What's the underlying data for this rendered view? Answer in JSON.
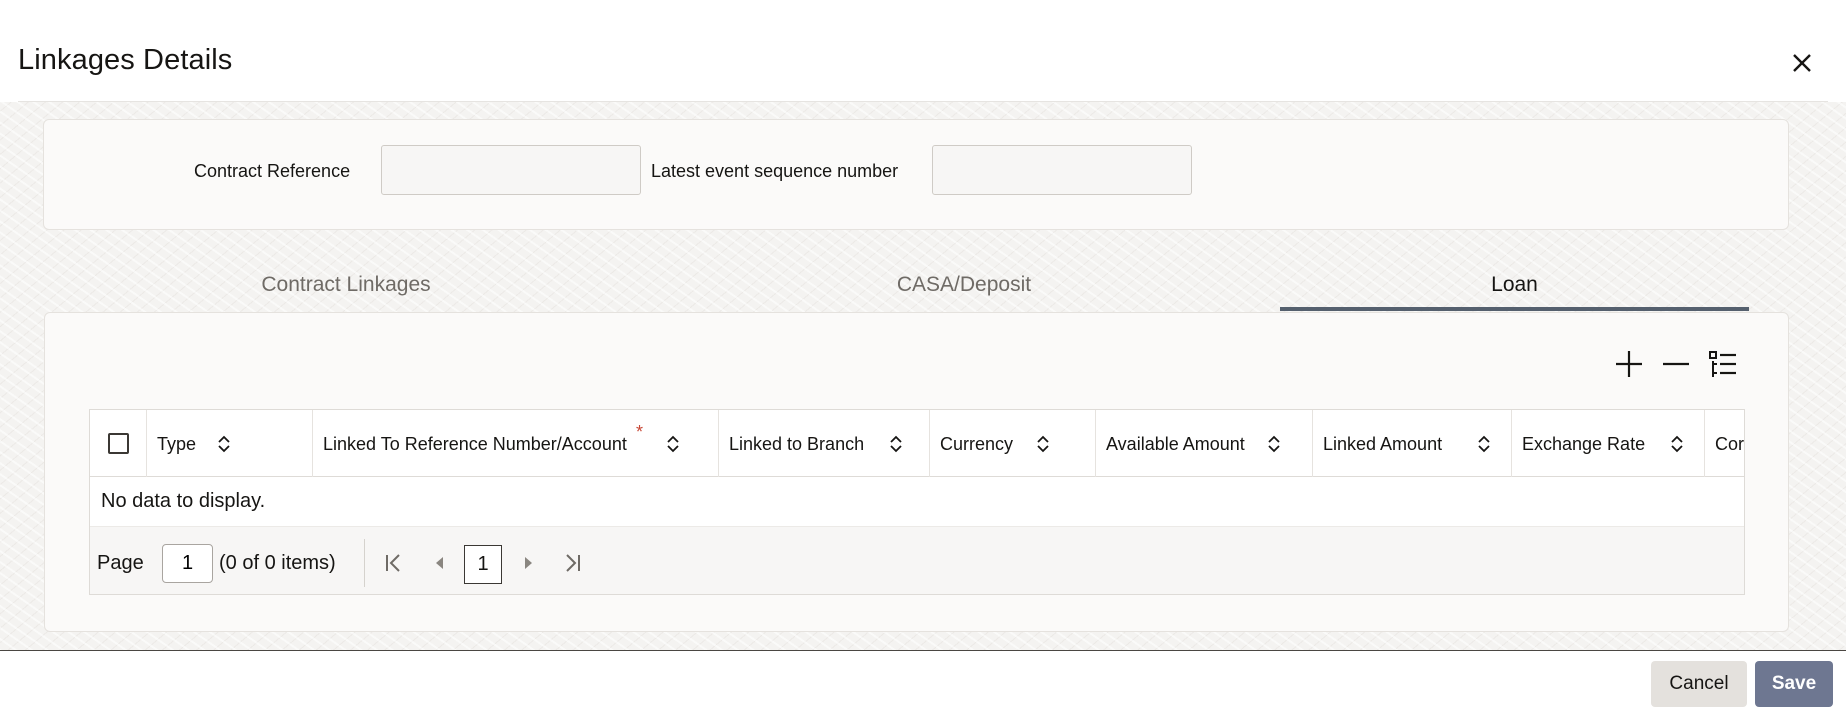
{
  "dialog": {
    "title": "Linkages Details",
    "close_icon": "close-icon"
  },
  "form": {
    "contract_reference_label": "Contract Reference",
    "contract_reference_value": "",
    "latest_event_label": "Latest event sequence number",
    "latest_event_value": ""
  },
  "tabs": [
    {
      "label": "Contract Linkages",
      "active": false
    },
    {
      "label": "CASA/Deposit",
      "active": false
    },
    {
      "label": "Loan",
      "active": true
    }
  ],
  "toolbar": {
    "icons": [
      "add-icon",
      "remove-icon",
      "column-list-icon"
    ]
  },
  "grid": {
    "columns": [
      {
        "label": "Type",
        "required": false
      },
      {
        "label": "Linked To Reference Number/Account",
        "required": true
      },
      {
        "label": "Linked to Branch",
        "required": false
      },
      {
        "label": "Currency",
        "required": false
      },
      {
        "label": "Available Amount",
        "required": false
      },
      {
        "label": "Linked Amount",
        "required": false
      },
      {
        "label": "Exchange Rate",
        "required": false
      },
      {
        "label": "Cor",
        "required": false
      }
    ],
    "required_marker": "*",
    "rows": [],
    "empty_text": "No data to display."
  },
  "pager": {
    "page_label": "Page",
    "page_value": "1",
    "items_text": "(0 of 0 items)",
    "current_page": "1"
  },
  "footer": {
    "cancel_label": "Cancel",
    "save_label": "Save"
  },
  "colors": {
    "accent": "#55606e",
    "save_button": "#6e7791",
    "required": "#c74634"
  }
}
